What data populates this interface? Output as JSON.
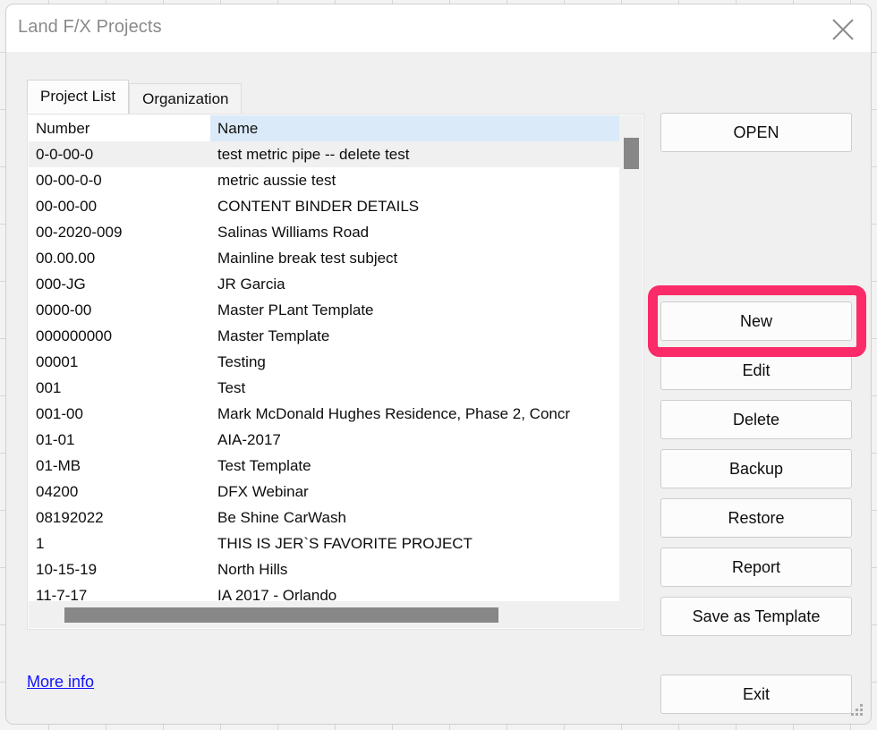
{
  "window": {
    "title": "Land F/X Projects",
    "close_icon": "close-icon"
  },
  "tabs": [
    {
      "label": "Project List",
      "active": true
    },
    {
      "label": "Organization",
      "active": false
    }
  ],
  "list": {
    "columns": [
      "Number",
      "Name"
    ],
    "selected_index": 0,
    "rows": [
      {
        "number": "0-0-00-0",
        "name": "test metric pipe -- delete test"
      },
      {
        "number": "00-00-0-0",
        "name": "metric aussie test"
      },
      {
        "number": "00-00-00",
        "name": "CONTENT BINDER DETAILS"
      },
      {
        "number": "00-2020-009",
        "name": "Salinas Williams Road"
      },
      {
        "number": "00.00.00",
        "name": "Mainline break test subject"
      },
      {
        "number": "000-JG",
        "name": "JR Garcia"
      },
      {
        "number": "0000-00",
        "name": "Master PLant Template"
      },
      {
        "number": "000000000",
        "name": "Master Template"
      },
      {
        "number": "00001",
        "name": "Testing"
      },
      {
        "number": "001",
        "name": "Test"
      },
      {
        "number": "001-00",
        "name": "Mark McDonald Hughes Residence, Phase 2, Concr"
      },
      {
        "number": "01-01",
        "name": "AIA-2017"
      },
      {
        "number": "01-MB",
        "name": "Test Template"
      },
      {
        "number": "04200",
        "name": "DFX Webinar"
      },
      {
        "number": "08192022",
        "name": "Be Shine CarWash"
      },
      {
        "number": "1",
        "name": "THIS IS JER`S FAVORITE PROJECT"
      },
      {
        "number": "10-15-19",
        "name": "North Hills"
      },
      {
        "number": "11-7-17",
        "name": "IA 2017 - Orlando"
      }
    ]
  },
  "links": {
    "more_info": "More info"
  },
  "buttons": {
    "open": "OPEN",
    "new": "New",
    "edit": "Edit",
    "delete": "Delete",
    "backup": "Backup",
    "restore": "Restore",
    "report": "Report",
    "save_as_template": "Save as Template",
    "exit": "Exit"
  },
  "highlight": {
    "target": "New",
    "color": "#fb2a68"
  },
  "colors": {
    "window_bg": "#f0f0f0",
    "titlebar_bg": "#ffffff",
    "name_header_bg": "#daeaf8",
    "selected_row_bg": "#f0f0f0",
    "link": "#1414ff",
    "scroll_thumb": "#878787"
  }
}
